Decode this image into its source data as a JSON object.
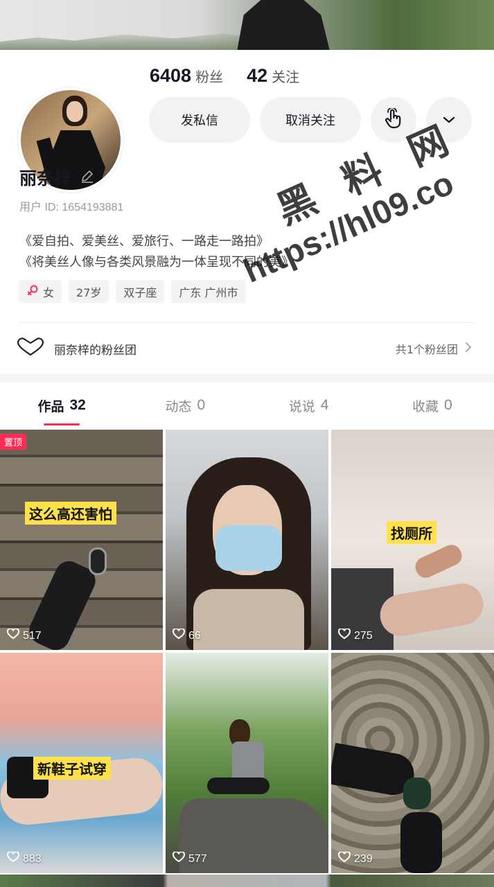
{
  "profile": {
    "followers_count": "6408",
    "followers_label": "粉丝",
    "following_count": "42",
    "following_label": "关注",
    "name": "丽奈梓",
    "user_id": "用户 ID: 1654193881",
    "bio_line1": "《爱自拍、爱美丝、爱旅行、一路走一路拍》",
    "bio_line2": "《将美丝人像与各类风景融为一体呈现不同的美》"
  },
  "actions": {
    "message_label": "发私信",
    "unfollow_label": "取消关注"
  },
  "tags": {
    "gender": "女",
    "age": "27岁",
    "zodiac": "双子座",
    "location": "广东 广州市"
  },
  "fanclub": {
    "title": "丽奈梓的粉丝团",
    "summary": "共1个粉丝团"
  },
  "tabs": [
    {
      "label": "作品",
      "count": "32"
    },
    {
      "label": "动态",
      "count": "0"
    },
    {
      "label": "说说",
      "count": "4"
    },
    {
      "label": "收藏",
      "count": "0"
    }
  ],
  "videos": [
    {
      "likes": "517",
      "caption": "这么高还害怕",
      "pinned": "置顶"
    },
    {
      "likes": "66"
    },
    {
      "likes": "275",
      "caption": "找厕所"
    },
    {
      "likes": "883",
      "caption": "新鞋子试穿"
    },
    {
      "likes": "577"
    },
    {
      "likes": "239"
    }
  ],
  "watermark": {
    "line1": "黑 料 网",
    "line2": "https://hl09.co"
  },
  "colors": {
    "accent": "#fe2c55",
    "caption_bg": "#ffe14a",
    "button_bg": "#f2f2f3"
  }
}
